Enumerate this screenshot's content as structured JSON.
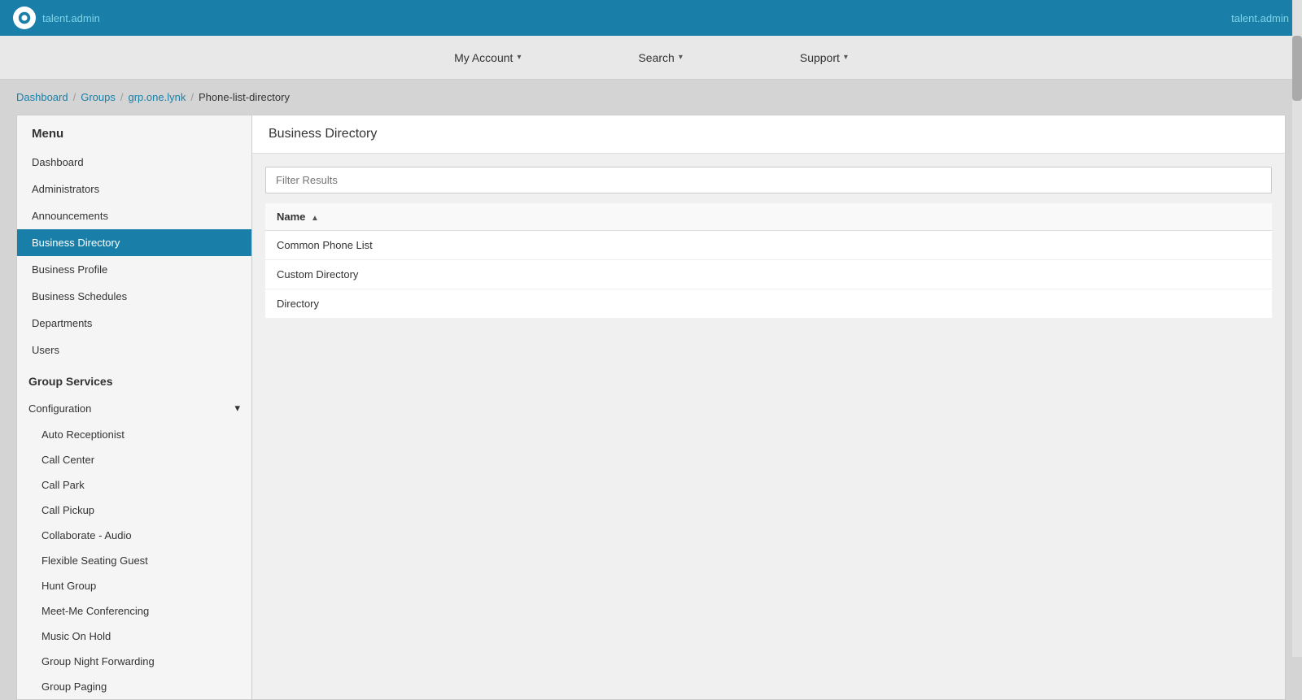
{
  "topbar": {
    "brand": "talent.admin",
    "user_label": "talent.admin"
  },
  "nav": {
    "items": [
      {
        "label": "My Account",
        "id": "my-account"
      },
      {
        "label": "Search",
        "id": "search"
      },
      {
        "label": "Support",
        "id": "support"
      }
    ]
  },
  "breadcrumb": {
    "items": [
      {
        "label": "Dashboard",
        "href": true
      },
      {
        "label": "Groups",
        "href": true
      },
      {
        "label": "grp.one.lynk",
        "href": true
      },
      {
        "label": "Phone-list-directory",
        "href": false
      }
    ]
  },
  "sidebar": {
    "menu_title": "Menu",
    "items": [
      {
        "label": "Dashboard",
        "active": false,
        "id": "dashboard"
      },
      {
        "label": "Administrators",
        "active": false,
        "id": "administrators"
      },
      {
        "label": "Announcements",
        "active": false,
        "id": "announcements"
      },
      {
        "label": "Business Directory",
        "active": true,
        "id": "business-directory"
      },
      {
        "label": "Business Profile",
        "active": false,
        "id": "business-profile"
      },
      {
        "label": "Business Schedules",
        "active": false,
        "id": "business-schedules"
      },
      {
        "label": "Departments",
        "active": false,
        "id": "departments"
      },
      {
        "label": "Users",
        "active": false,
        "id": "users"
      }
    ],
    "group_services_title": "Group Services",
    "configuration": {
      "label": "Configuration",
      "chevron": "▾",
      "sub_items": [
        {
          "label": "Auto Receptionist",
          "id": "auto-receptionist"
        },
        {
          "label": "Call Center",
          "id": "call-center"
        },
        {
          "label": "Call Park",
          "id": "call-park"
        },
        {
          "label": "Call Pickup",
          "id": "call-pickup"
        },
        {
          "label": "Collaborate - Audio",
          "id": "collaborate-audio"
        },
        {
          "label": "Flexible Seating Guest",
          "id": "flexible-seating-guest"
        },
        {
          "label": "Hunt Group",
          "id": "hunt-group"
        },
        {
          "label": "Meet-Me Conferencing",
          "id": "meet-me-conferencing"
        },
        {
          "label": "Music On Hold",
          "id": "music-on-hold"
        },
        {
          "label": "Group Night Forwarding",
          "id": "group-night-forwarding"
        },
        {
          "label": "Group Paging",
          "id": "group-paging"
        }
      ]
    }
  },
  "content": {
    "title": "Business Directory",
    "filter_placeholder": "Filter Results",
    "table": {
      "column_name": "Name",
      "sort_icon": "▲",
      "rows": [
        {
          "name": "Common Phone List"
        },
        {
          "name": "Custom Directory"
        },
        {
          "name": "Directory"
        }
      ]
    }
  }
}
